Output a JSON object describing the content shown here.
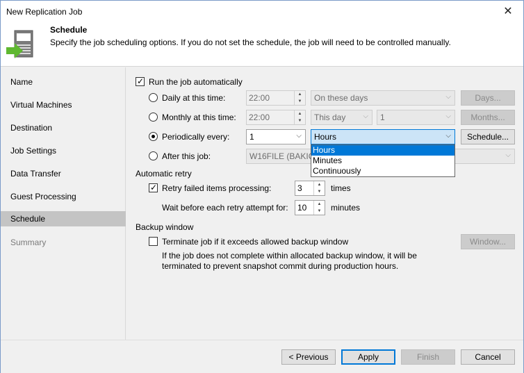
{
  "window": {
    "title": "New Replication Job",
    "close_glyph": "✕"
  },
  "header": {
    "icon": "server-arrow-icon",
    "title": "Schedule",
    "description": "Specify the job scheduling options. If you do not set the schedule, the job will need to be controlled manually."
  },
  "sidebar": {
    "items": [
      {
        "label": "Name",
        "state": "normal"
      },
      {
        "label": "Virtual Machines",
        "state": "normal"
      },
      {
        "label": "Destination",
        "state": "normal"
      },
      {
        "label": "Job Settings",
        "state": "normal"
      },
      {
        "label": "Data Transfer",
        "state": "normal"
      },
      {
        "label": "Guest Processing",
        "state": "normal"
      },
      {
        "label": "Schedule",
        "state": "active"
      },
      {
        "label": "Summary",
        "state": "disabled"
      }
    ]
  },
  "schedule": {
    "run_auto": {
      "label": "Run the job automatically",
      "checked": true
    },
    "daily": {
      "label": "Daily at this time:",
      "time": "22:00",
      "days_select": "On these days",
      "days_button": "Days..."
    },
    "monthly": {
      "label": "Monthly at this time:",
      "time": "22:00",
      "day_select": "This day",
      "num_select": "1",
      "months_button": "Months..."
    },
    "periodically": {
      "label": "Periodically every:",
      "value": "1",
      "unit": "Hours",
      "schedule_button": "Schedule..."
    },
    "after_job": {
      "label": "After this job:",
      "value": "W16FILE (BAKICU"
    },
    "unit_options": [
      "Hours",
      "Minutes",
      "Continuously"
    ],
    "selected_unit_index": 0
  },
  "retry": {
    "group_label": "Automatic retry",
    "retry_label": "Retry failed items processing:",
    "retry_value": "3",
    "retry_unit": "times",
    "wait_label": "Wait before each retry attempt for:",
    "wait_value": "10",
    "wait_unit": "minutes"
  },
  "backup_window": {
    "group_label": "Backup window",
    "terminate_label": "Terminate job if it exceeds allowed backup window",
    "note_line1": "If the job does not complete within allocated backup window, it will be",
    "note_line2": "terminated to prevent snapshot commit during production hours.",
    "window_button": "Window..."
  },
  "footer": {
    "previous": "< Previous",
    "apply": "Apply",
    "finish": "Finish",
    "cancel": "Cancel"
  },
  "colors": {
    "accent": "#0078d7",
    "sidebar_active": "#c4c4c4"
  }
}
